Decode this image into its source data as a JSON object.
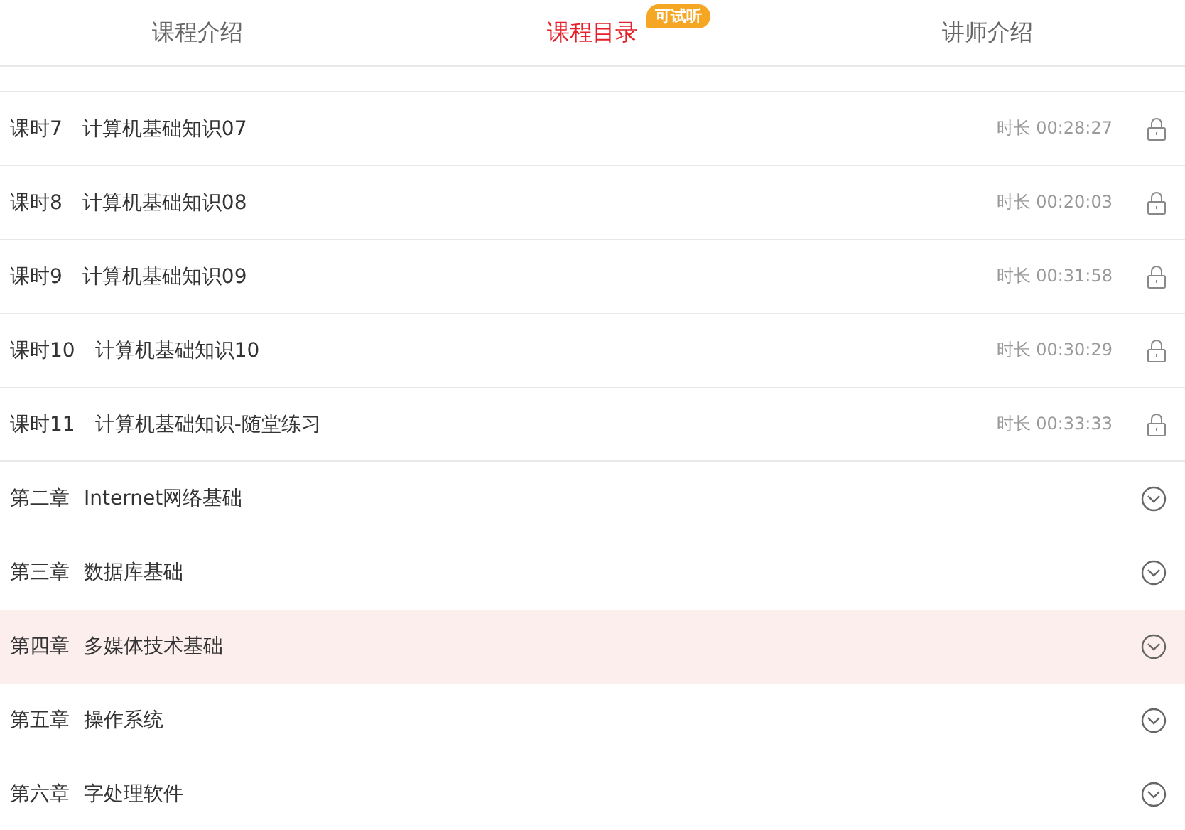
{
  "tabs": [
    {
      "label": "课程介绍",
      "selected": false
    },
    {
      "label": "课程目录",
      "selected": true,
      "badge": "可试听"
    },
    {
      "label": "讲师介绍",
      "selected": false
    }
  ],
  "lessons": [
    {
      "number": "课时7",
      "title": "计算机基础知识07",
      "duration": "时长 00:28:27",
      "locked": true
    },
    {
      "number": "课时8",
      "title": "计算机基础知识08",
      "duration": "时长 00:20:03",
      "locked": true
    },
    {
      "number": "课时9",
      "title": "计算机基础知识09",
      "duration": "时长 00:31:58",
      "locked": true
    },
    {
      "number": "课时10",
      "title": "计算机基础知识10",
      "duration": "时长 00:30:29",
      "locked": true
    },
    {
      "number": "课时11",
      "title": "计算机基础知识-随堂练习",
      "duration": "时长 00:33:33",
      "locked": true
    }
  ],
  "chapters": [
    {
      "number": "第二章",
      "title": "Internet网络基础",
      "selected": false,
      "expanded": false
    },
    {
      "number": "第三章",
      "title": "数据库基础",
      "selected": false,
      "expanded": false
    },
    {
      "number": "第四章",
      "title": "多媒体技术基础",
      "selected": true,
      "expanded": false
    },
    {
      "number": "第五章",
      "title": "操作系统",
      "selected": false,
      "expanded": false
    },
    {
      "number": "第六章",
      "title": "字处理软件",
      "selected": false,
      "expanded": false
    }
  ]
}
